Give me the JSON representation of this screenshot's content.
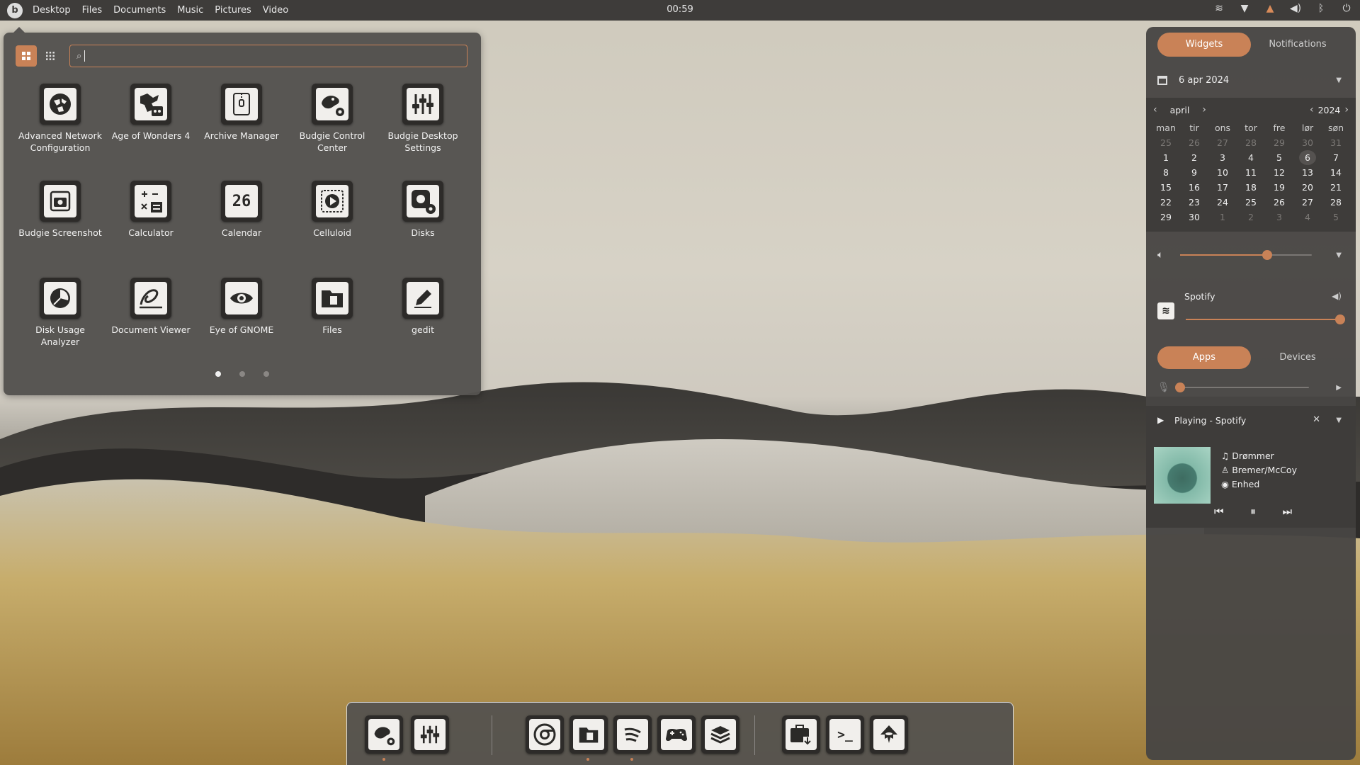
{
  "topbar": {
    "menu": [
      "Desktop",
      "Files",
      "Documents",
      "Music",
      "Pictures",
      "Video"
    ],
    "clock": "00:59"
  },
  "launcher": {
    "search": {
      "value": "",
      "placeholder": ""
    },
    "apps": [
      {
        "name": "Advanced Network Configuration",
        "icon": "network-icon"
      },
      {
        "name": "Age of Wonders 4",
        "icon": "dragon-game-icon"
      },
      {
        "name": "Archive Manager",
        "icon": "archive-icon"
      },
      {
        "name": "Budgie Control Center",
        "icon": "budgie-settings-icon"
      },
      {
        "name": "Budgie Desktop Settings",
        "icon": "sliders-icon"
      },
      {
        "name": "Budgie Screenshot",
        "icon": "camera-icon"
      },
      {
        "name": "Calculator",
        "icon": "calculator-icon"
      },
      {
        "name": "Calendar",
        "icon": "calendar-icon"
      },
      {
        "name": "Celluloid",
        "icon": "play-icon"
      },
      {
        "name": "Disks",
        "icon": "disk-icon"
      },
      {
        "name": "Disk Usage Analyzer",
        "icon": "pie-chart-icon"
      },
      {
        "name": "Document Viewer",
        "icon": "document-viewer-icon"
      },
      {
        "name": "Eye of GNOME",
        "icon": "eye-icon"
      },
      {
        "name": "Files",
        "icon": "folder-icon"
      },
      {
        "name": "gedit",
        "icon": "pencil-icon"
      }
    ],
    "calendar_icon_text": "26",
    "pages": 3,
    "active_page": 1
  },
  "sidepanel": {
    "tabs": [
      "Widgets",
      "Notifications"
    ],
    "date": "6 apr 2024",
    "calendar": {
      "month": "april",
      "year": "2024",
      "weekdays": [
        "man",
        "tir",
        "ons",
        "tor",
        "fre",
        "lør",
        "søn"
      ],
      "weeks": [
        [
          "25",
          "26",
          "27",
          "28",
          "29",
          "30",
          "31"
        ],
        [
          "1",
          "2",
          "3",
          "4",
          "5",
          "6",
          "7"
        ],
        [
          "8",
          "9",
          "10",
          "11",
          "12",
          "13",
          "14"
        ],
        [
          "15",
          "16",
          "17",
          "18",
          "19",
          "20",
          "21"
        ],
        [
          "22",
          "23",
          "24",
          "25",
          "26",
          "27",
          "28"
        ],
        [
          "29",
          "30",
          "1",
          "2",
          "3",
          "4",
          "5"
        ]
      ],
      "today": "6"
    },
    "master_volume": 0.66,
    "app_volume": {
      "app": "Spotify",
      "level": 1.0
    },
    "mini_tabs": [
      "Apps",
      "Devices"
    ],
    "mic_level": 0.0,
    "player": {
      "status": "Playing - Spotify",
      "title": "Drømmer",
      "artist": "Bremer/McCoy",
      "album": "Enhed"
    }
  },
  "dock": {
    "items": [
      "budgie-settings-icon",
      "sliders-icon",
      "chrome-icon",
      "folder-icon",
      "spotify-icon",
      "gamepad-icon",
      "stack-icon",
      "software-install-icon",
      "terminal-icon",
      "inkscape-icon"
    ]
  }
}
